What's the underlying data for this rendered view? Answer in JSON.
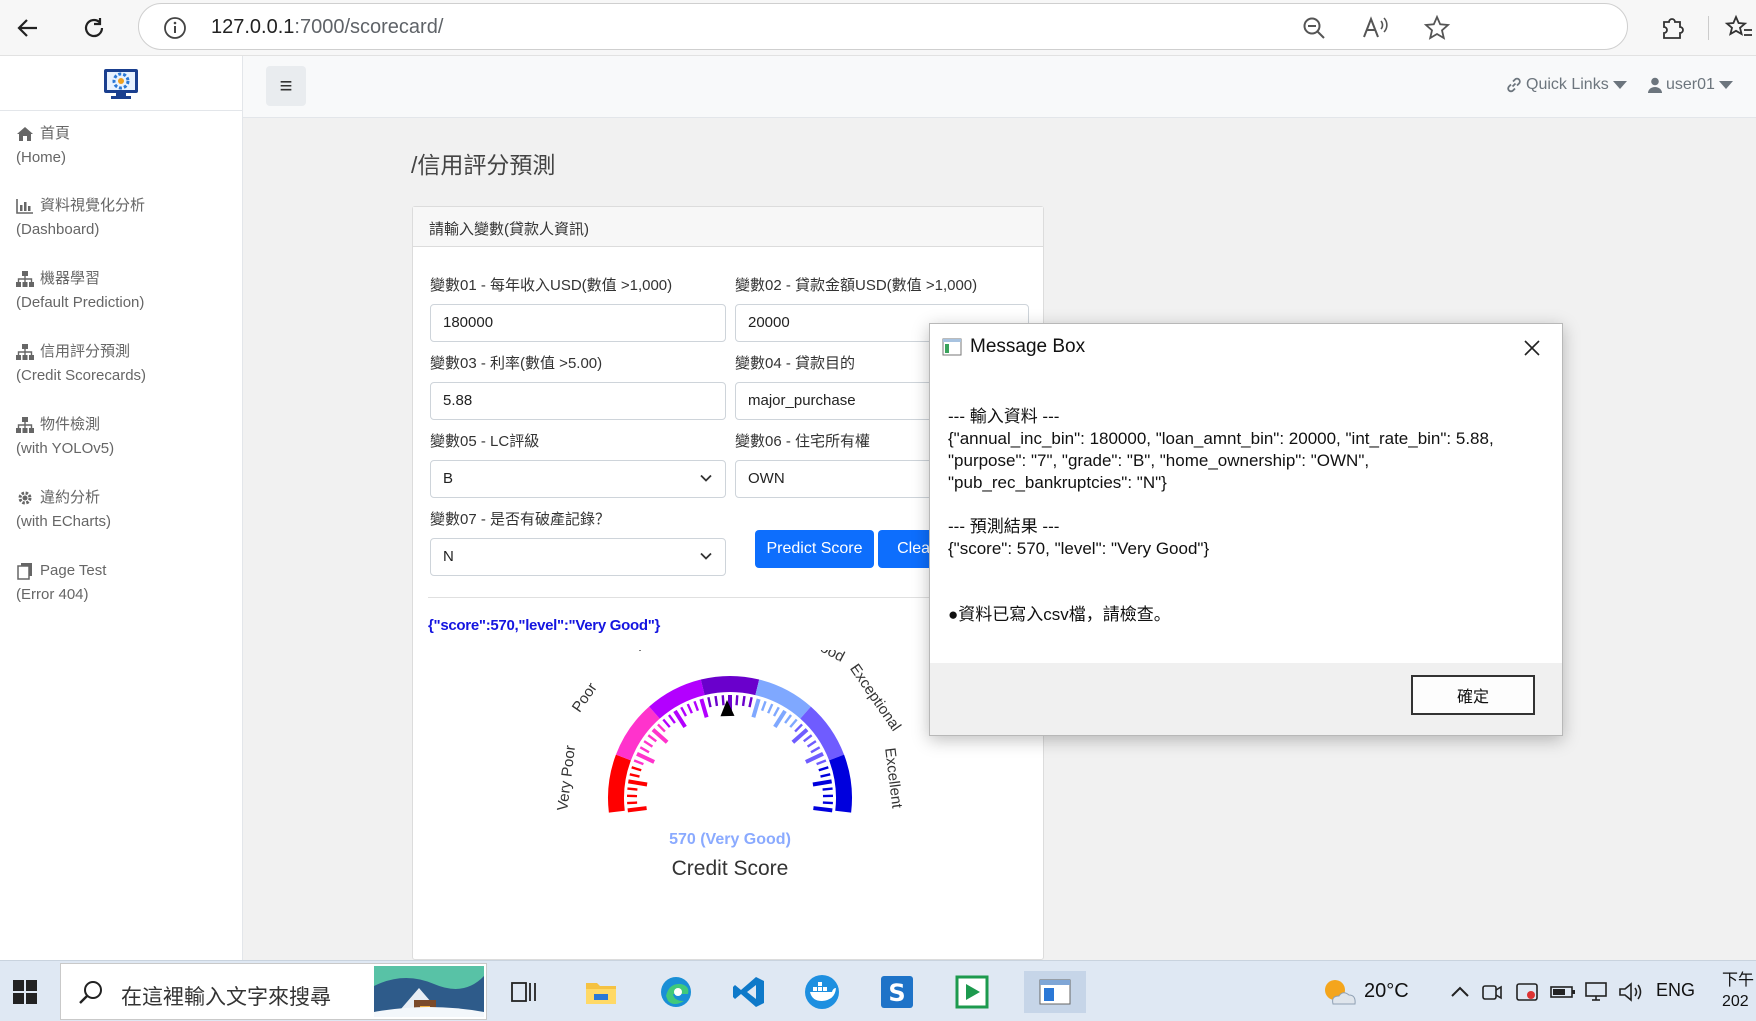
{
  "browser": {
    "url_host": "127.0.0.1",
    "url_rest": ":7000/scorecard/"
  },
  "topnav": {
    "toggle_glyph": "≡",
    "quick_links": "Quick Links",
    "user": "user01"
  },
  "sidebar": {
    "items": [
      {
        "zh": "首頁",
        "en": "(Home)",
        "icon": "home-icon"
      },
      {
        "zh": "資料視覺化分析",
        "en": "(Dashboard)",
        "icon": "bar-chart-icon"
      },
      {
        "zh": "機器學習",
        "en": "(Default Prediction)",
        "icon": "sitemap-icon"
      },
      {
        "zh": "信用評分預測",
        "en": "(Credit Scorecards)",
        "icon": "sitemap-icon"
      },
      {
        "zh": "物件檢測",
        "en": "(with YOLOv5)",
        "icon": "sitemap-icon"
      },
      {
        "zh": "違約分析",
        "en": "(with ECharts)",
        "icon": "gear-icon"
      },
      {
        "zh": "Page Test",
        "en": "(Error 404)",
        "icon": "files-icon"
      }
    ]
  },
  "page": {
    "title": "/信用評分預測",
    "card_header": "請輸入變數(貸款人資訊)"
  },
  "form": {
    "var01_label": "變數01 - 每年收入USD(數值 >1,000)",
    "var01_value": "180000",
    "var02_label": "變數02 - 貸款金額USD(數值 >1,000)",
    "var02_value": "20000",
    "var03_label": "變數03 - 利率(數值 >5.00)",
    "var03_value": "5.88",
    "var04_label": "變數04 - 貸款目的",
    "var04_value": "major_purchase",
    "var05_label": "變數05 - LC評級",
    "var05_value": "B",
    "var06_label": "變數06 - 住宅所有權",
    "var06_value": "OWN",
    "var07_label": "變數07 - 是否有破產記錄？",
    "var07_value": "N",
    "predict_label": "Predict Score",
    "clean_label": "Clean"
  },
  "result_json": "{\"score\":570,\"level\":\"Very Good\"}",
  "gauge": {
    "score": 570,
    "min": 300,
    "max": 850,
    "score_text": "570 (Very Good)",
    "title": "Credit Score",
    "bands": [
      {
        "label": "Very Poor",
        "color": "#ff0000"
      },
      {
        "label": "Poor",
        "color": "#ff33cc"
      },
      {
        "label": "Fair",
        "color": "#b300ff"
      },
      {
        "label": "Good",
        "color": "#6a00cc"
      },
      {
        "label": "Very Good",
        "color": "#7fa8ff"
      },
      {
        "label": "Exceptional",
        "color": "#6f5cff"
      },
      {
        "label": "Excellent",
        "color": "#0000dd"
      }
    ]
  },
  "msgbox": {
    "title": "Message Box",
    "line1": "--- 輸入資料 ---",
    "line2": "{\"annual_inc_bin\": 180000, \"loan_amnt_bin\": 20000, \"int_rate_bin\": 5.88,",
    "line3": "\"purpose\": \"7\", \"grade\": \"B\", \"home_ownership\": \"OWN\",",
    "line4": "\"pub_rec_bankruptcies\": \"N\"}",
    "line5": "--- 預測結果 ---",
    "line6": "{\"score\": 570, \"level\": \"Very Good\"}",
    "line7": "●資料已寫入csv檔，請檢查。",
    "ok_label": "確定"
  },
  "taskbar": {
    "search_placeholder": "在這裡輸入文字來搜尋",
    "temperature": "20°C",
    "language": "ENG",
    "clock_partial": "下午",
    "date_partial": "202"
  }
}
